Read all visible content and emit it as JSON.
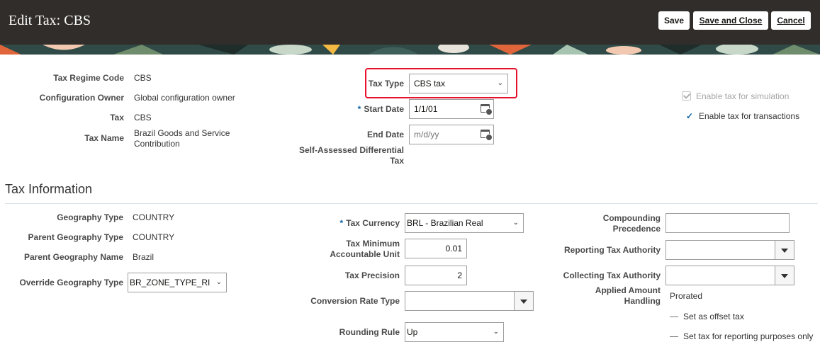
{
  "header": {
    "title": "Edit Tax: CBS",
    "save_label": "Save",
    "save_close_label": "Save and Close",
    "cancel_label": "Cancel"
  },
  "general": {
    "tax_regime_code": {
      "label": "Tax Regime Code",
      "value": "CBS"
    },
    "configuration_owner": {
      "label": "Configuration Owner",
      "value": "Global configuration owner"
    },
    "tax": {
      "label": "Tax",
      "value": "CBS"
    },
    "tax_name": {
      "label": "Tax Name",
      "value": "Brazil Goods and Service Contribution"
    },
    "tax_type": {
      "label": "Tax Type",
      "value": "CBS tax"
    },
    "start_date": {
      "label": "Start Date",
      "value": "1/1/01"
    },
    "end_date": {
      "label": "End Date",
      "placeholder": "m/d/yy"
    },
    "self_assessed": {
      "label": "Self-Assessed Differential Tax"
    },
    "enable_simulation": {
      "label": "Enable tax for simulation",
      "checked": true,
      "disabled": true
    },
    "enable_transactions": {
      "label": "Enable tax for transactions",
      "checked": true
    }
  },
  "tax_information": {
    "title": "Tax Information",
    "geography_type": {
      "label": "Geography Type",
      "value": "COUNTRY"
    },
    "parent_geography_type": {
      "label": "Parent Geography Type",
      "value": "COUNTRY"
    },
    "parent_geography_name": {
      "label": "Parent Geography Name",
      "value": "Brazil"
    },
    "override_geography_type": {
      "label": "Override Geography Type",
      "value": "BR_ZONE_TYPE_RI"
    },
    "tax_currency": {
      "label": "Tax Currency",
      "value": "BRL - Brazilian Real"
    },
    "tax_minimum_unit": {
      "label": "Tax Minimum Accountable Unit",
      "value": "0.01"
    },
    "tax_precision": {
      "label": "Tax Precision",
      "value": "2"
    },
    "conversion_rate_type": {
      "label": "Conversion Rate Type",
      "value": ""
    },
    "rounding_rule": {
      "label": "Rounding Rule",
      "value": "Up"
    },
    "compounding_precedence": {
      "label": "Compounding Precedence",
      "value": ""
    },
    "reporting_tax_authority": {
      "label": "Reporting Tax Authority",
      "value": ""
    },
    "collecting_tax_authority": {
      "label": "Collecting Tax Authority",
      "value": ""
    },
    "applied_amount_handling": {
      "label": "Applied Amount Handling",
      "value": "Prorated"
    },
    "set_offset_tax": {
      "label": "Set as offset tax",
      "checked": false
    },
    "set_reporting_only": {
      "label": "Set tax for reporting purposes only",
      "checked": false
    }
  },
  "colors": {
    "header_bg": "#312d2a",
    "highlight": "#e8112d",
    "required": "#0d63a5"
  }
}
